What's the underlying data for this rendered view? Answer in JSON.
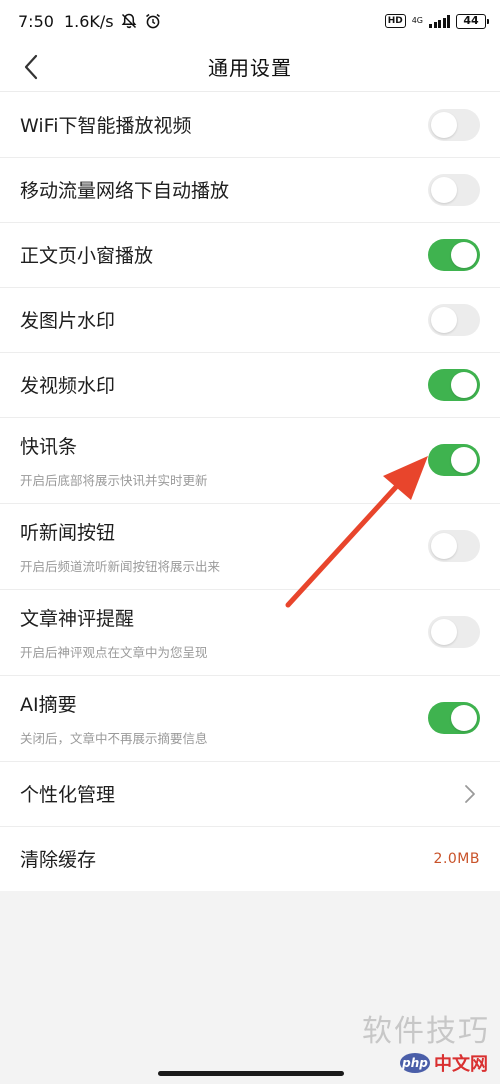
{
  "status_bar": {
    "time": "7:50",
    "speed": "1.6K/s",
    "hd": "HD",
    "network": "4G",
    "battery": "44"
  },
  "header": {
    "title": "通用设置"
  },
  "settings": [
    {
      "title": "WiFi下智能播放视频",
      "desc": "",
      "enabled": false
    },
    {
      "title": "移动流量网络下自动播放",
      "desc": "",
      "enabled": false
    },
    {
      "title": "正文页小窗播放",
      "desc": "",
      "enabled": true
    },
    {
      "title": "发图片水印",
      "desc": "",
      "enabled": false
    },
    {
      "title": "发视频水印",
      "desc": "",
      "enabled": true
    },
    {
      "title": "快讯条",
      "desc": "开启后底部将展示快讯并实时更新",
      "enabled": true
    },
    {
      "title": "听新闻按钮",
      "desc": "开启后频道流听新闻按钮将展示出来",
      "enabled": false
    },
    {
      "title": "文章神评提醒",
      "desc": "开启后神评观点在文章中为您呈现",
      "enabled": false
    },
    {
      "title": "AI摘要",
      "desc": "关闭后，文章中不再展示摘要信息",
      "enabled": true
    }
  ],
  "personalization": {
    "label": "个性化管理"
  },
  "cache": {
    "label": "清除缓存",
    "value": "2.0MB"
  },
  "watermark": {
    "text": "软件技巧",
    "logo": "php",
    "site": "中文网"
  },
  "colors": {
    "toggle_on": "#3fb34f",
    "toggle_off": "#ececec",
    "annotation_arrow": "#e8452c",
    "cache_value": "#c9532a"
  }
}
